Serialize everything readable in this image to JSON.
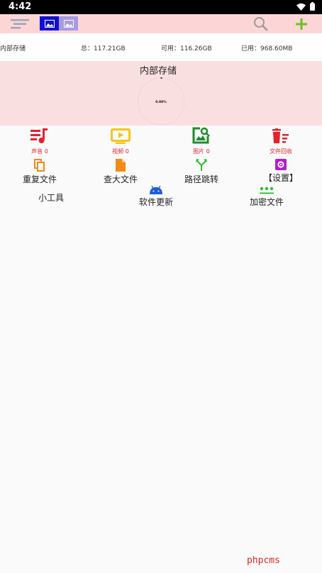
{
  "status": {
    "time": "4:42"
  },
  "toolbar": {
    "icons": [
      "menu-icon",
      "image-view-icon",
      "image-view-alt-icon",
      "search-icon",
      "add-icon"
    ]
  },
  "storage": {
    "name_label": "内部存储",
    "total": "总：117.21GB",
    "available": "可用：116.26GB",
    "used": "已用：968.60MB",
    "panel_title": "内部存储",
    "ring_text": "0.80%",
    "used_fraction": 0.008
  },
  "categories": [
    {
      "label": "声音 0",
      "icon": "music-list-icon",
      "color": "#e8202a"
    },
    {
      "label": "视频 0",
      "icon": "video-icon",
      "color": "#f5c518"
    },
    {
      "label": "图片 0",
      "icon": "image-search-icon",
      "color": "#1f8c2a"
    },
    {
      "label": "文件回收",
      "icon": "recycle-bin-icon",
      "color": "#e8202a"
    }
  ],
  "tools": {
    "duplicate": "重复文件",
    "large": "查大文件",
    "jump": "路径跳转",
    "settings": "【设置】",
    "utilities": "小工具",
    "update": "软件更新",
    "encrypt": "加密文件"
  },
  "colors": {
    "toolbar_bg": "#fcd6d6",
    "panel_bg": "#f9dfdf",
    "add": "#6bbf2a"
  },
  "watermark": "phpcms"
}
